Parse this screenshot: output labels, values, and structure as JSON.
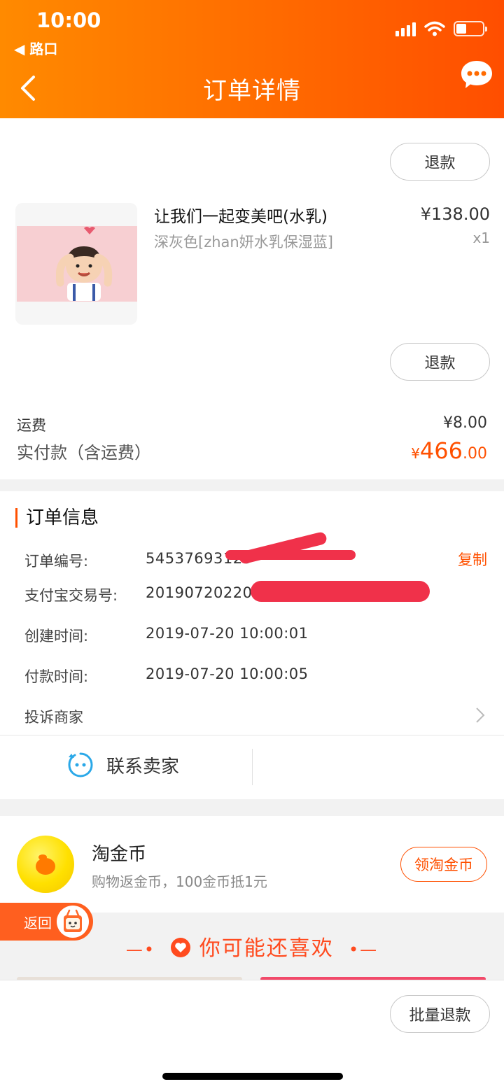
{
  "status_bar": {
    "time": "10:00",
    "back_app": "◀ 路口"
  },
  "nav": {
    "title": "订单详情"
  },
  "product": {
    "title": "让我们一起变美吧(水乳)",
    "spec": "深灰色[zhan妍水乳保湿蓝]",
    "price": "¥138.00",
    "qty": "x1",
    "refund_label": "退款"
  },
  "refund_top_label": "退款",
  "fees": {
    "shipping_label": "运费",
    "shipping_value": "¥8.00",
    "paid_label": "实付款（含运费）",
    "paid_currency": "¥",
    "paid_int": "466",
    "paid_dec": ".00"
  },
  "order_info": {
    "title": "订单信息",
    "order_no_label": "订单编号:",
    "order_no_value": "54537693129",
    "copy_label": "复制",
    "alipay_label": "支付宝交易号:",
    "alipay_value": "2019072022001",
    "created_label": "创建时间:",
    "created_value": "2019-07-20 10:00:01",
    "paid_time_label": "付款时间:",
    "paid_time_value": "2019-07-20 10:00:05",
    "complain_label": "投诉商家",
    "contact_label": "联系卖家"
  },
  "coins": {
    "title": "淘金币",
    "desc": "购物返金币，100金币抵1元",
    "button": "领淘金币"
  },
  "return_tab": "返回",
  "recommend_title": "你可能还喜欢",
  "bottom": {
    "batch_refund": "批量退款"
  },
  "colors": {
    "accent": "#ff5000",
    "header_start": "#ff8a00",
    "header_end": "#ff4e00"
  }
}
